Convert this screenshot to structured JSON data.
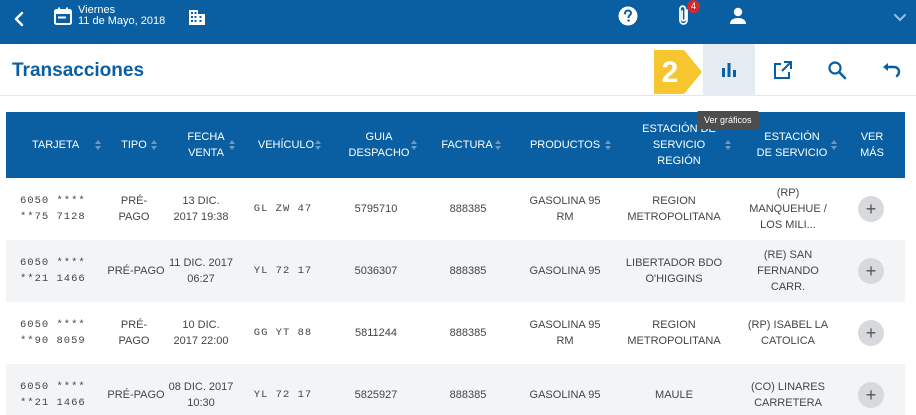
{
  "topbar": {
    "date_line1": "Viernes",
    "date_line2": "11 de Mayo, 2018",
    "notification_count": "4",
    "accent": "#0a5fa3"
  },
  "page": {
    "title": "Transacciones",
    "step_number": "2",
    "tooltip": "Ver gráficos"
  },
  "table": {
    "headers": [
      "TARJETA",
      "TIPO",
      "FECHA VENTA",
      "VEHÍCULO",
      "GUIA DESPACHO",
      "FACTURA",
      "PRODUCTOS",
      "ESTACIÓN DE SERVICIO REGIÓN",
      "ESTACIÓN DE SERVICIO",
      "VER MÁS"
    ],
    "rows": [
      {
        "card": "6050 **** **75 7128",
        "type": "PRÉ-PAGO",
        "date": "13 DIC. 2017 19:38",
        "vehicle": "GL ZW 47",
        "guide": "5795710",
        "invoice": "888385",
        "product": "GASOLINA 95 RM",
        "region": "REGION METROPOLITANA",
        "station": "(RP) MANQUEHUE / LOS MILI..."
      },
      {
        "card": "6050 **** **21 1466",
        "type": "PRÉ-PAGO",
        "date": "11 DIC. 2017 06:27",
        "vehicle": "YL 72 17",
        "guide": "5036307",
        "invoice": "888385",
        "product": "GASOLINA 95",
        "region": "LIBERTADOR BDO O'HIGGINS",
        "station": "(RE) SAN FERNANDO CARR."
      },
      {
        "card": "6050 **** **90 8059",
        "type": "PRÉ-PAGO",
        "date": "10 DIC. 2017 22:00",
        "vehicle": "GG YT 88",
        "guide": "5811244",
        "invoice": "888385",
        "product": "GASOLINA 95 RM",
        "region": "REGION METROPOLITANA",
        "station": "(RP) ISABEL LA CATOLICA"
      },
      {
        "card": "6050 **** **21 1466",
        "type": "PRÉ-PAGO",
        "date": "08 DIC. 2017 10:30",
        "vehicle": "YL 72 17",
        "guide": "5825927",
        "invoice": "888385",
        "product": "GASOLINA 95",
        "region": "MAULE",
        "station": "(CO) LINARES CARRETERA"
      }
    ]
  }
}
